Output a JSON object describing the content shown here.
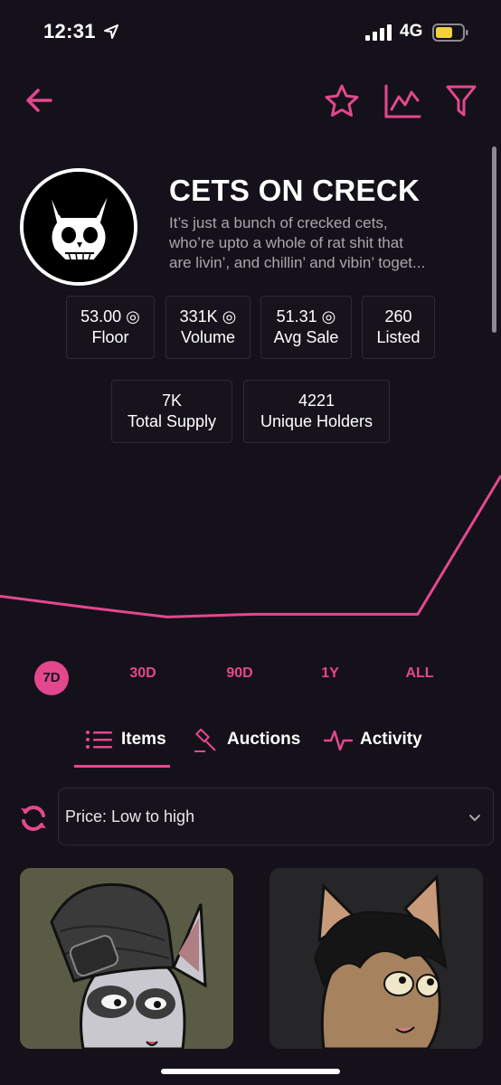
{
  "status": {
    "time": "12:31",
    "network": "4G"
  },
  "collection": {
    "title": "CETS ON CRECK",
    "description_lines": [
      "It’s just a bunch of crecked cets,",
      "who’re upto a whole of rat shit that",
      "are livin’, and chillin’ and vibin’ toget..."
    ]
  },
  "stats": {
    "floor": {
      "value": "53.00 ◎",
      "label": "Floor"
    },
    "volume": {
      "value": "331K ◎",
      "label": "Volume"
    },
    "avg_sale": {
      "value": "51.31 ◎",
      "label": "Avg Sale"
    },
    "listed": {
      "value": "260",
      "label": "Listed"
    },
    "total_supply": {
      "value": "7K",
      "label": "Total Supply"
    },
    "unique_holders": {
      "value": "4221",
      "label": "Unique Holders"
    }
  },
  "chart_data": {
    "type": "line",
    "title": "",
    "xlabel": "",
    "ylabel": "",
    "grid": false,
    "x": [
      0,
      1,
      2,
      3,
      4,
      5,
      6
    ],
    "values": [
      0.66,
      0.5,
      0.36,
      0.4,
      0.4,
      0.4,
      2.4
    ],
    "ylim": [
      0,
      3
    ]
  },
  "ranges": [
    "7D",
    "30D",
    "90D",
    "1Y",
    "ALL"
  ],
  "active_range": "7D",
  "tabs": {
    "items": "Items",
    "auctions": "Auctions",
    "activity": "Activity"
  },
  "sort": {
    "selected": "Price: Low to high"
  },
  "icons": {
    "back": "arrow-left-icon",
    "favorite": "star-icon",
    "stats": "line-chart-icon",
    "filter": "funnel-icon",
    "refresh": "refresh-icon",
    "dropdown": "chevron-down-icon"
  },
  "colors": {
    "accent": "#e3488d",
    "background": "#15111a",
    "card_border": "#2e2933",
    "muted_text": "#a9a6ad"
  }
}
